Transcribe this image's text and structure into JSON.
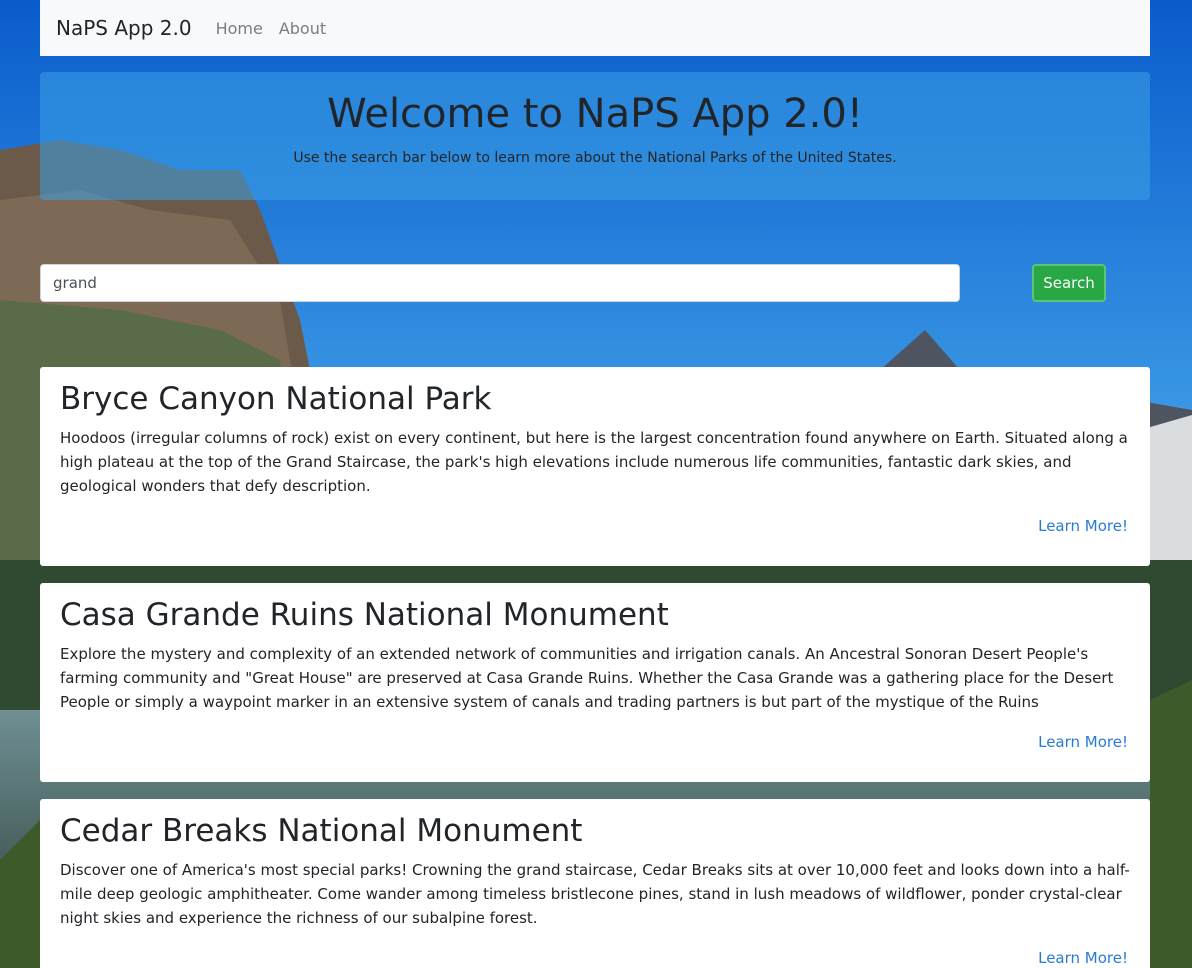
{
  "navbar": {
    "brand": "NaPS App 2.0",
    "links": [
      "Home",
      "About"
    ]
  },
  "jumbotron": {
    "title": "Welcome to NaPS App 2.0!",
    "subtitle": "Use the search bar below to learn more about the National Parks of the United States."
  },
  "search": {
    "value": "grand",
    "button_label": "Search"
  },
  "results": [
    {
      "title": "Bryce Canyon National Park",
      "description": "Hoodoos (irregular columns of rock) exist on every continent, but here is the largest concentration found anywhere on Earth. Situated along a high plateau at the top of the Grand Staircase, the park's high elevations include numerous life communities, fantastic dark skies, and geological wonders that defy description.",
      "link": "Learn More!"
    },
    {
      "title": "Casa Grande Ruins National Monument",
      "description": "Explore the mystery and complexity of an extended network of communities and irrigation canals. An Ancestral Sonoran Desert People's farming community and \"Great House\" are preserved at Casa Grande Ruins. Whether the Casa Grande was a gathering place for the Desert People or simply a waypoint marker in an extensive system of canals and trading partners is but part of the mystique of the Ruins",
      "link": "Learn More!"
    },
    {
      "title": "Cedar Breaks National Monument",
      "description": "Discover one of America's most special parks! Crowning the grand staircase, Cedar Breaks sits at over 10,000 feet and looks down into a half-mile deep geologic amphitheater. Come wander among timeless bristlecone pines, stand in lush meadows of wildflower, ponder crystal-clear night skies and experience the richness of our subalpine forest.",
      "link": "Learn More!"
    }
  ]
}
